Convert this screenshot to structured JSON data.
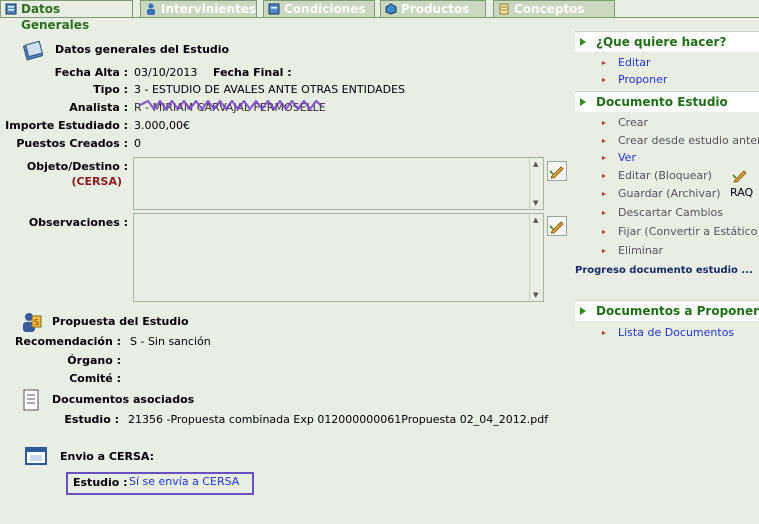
{
  "tabs": [
    {
      "label": "Datos Generales",
      "active": true,
      "icon": "document-icon"
    },
    {
      "label": "Intervinientes",
      "active": false,
      "icon": "person-icon"
    },
    {
      "label": "Condiciones",
      "active": false,
      "icon": "document-icon"
    },
    {
      "label": "Productos",
      "active": false,
      "icon": "cube-icon"
    },
    {
      "label": "Conceptos",
      "active": false,
      "icon": "notes-icon"
    }
  ],
  "general": {
    "title": "Datos generales del Estudio",
    "fecha_alta_label": "Fecha Alta :",
    "fecha_alta_value": "03/10/2013",
    "fecha_final_label": "Fecha Final :",
    "tipo_label": "Tipo :",
    "tipo_value": "3 - ESTUDIO DE AVALES ANTE OTRAS ENTIDADES",
    "analista_label": "Analista :",
    "analista_value": "R - MIRIAM CARVAJAL FERMOSELLE",
    "importe_label": "Importe Estudiado :",
    "importe_value": "3.000,00€",
    "puestos_label": "Puestos Creados :",
    "puestos_value": "0",
    "objeto_label": "Objeto/Destino :",
    "objeto_sub": "(CERSA)",
    "observaciones_label": "Observaciones :"
  },
  "propuesta": {
    "title": "Propuesta del Estudio",
    "recomendacion_label": "Recomendación :",
    "recomendacion_value": "S - Sin sanción",
    "organo_label": "Órgano :",
    "comite_label": "Comité :"
  },
  "documentos": {
    "title": "Documentos asociados",
    "estudio_label": "Estudio :",
    "estudio_value": "21356 -Propuesta combinada Exp 012000000061Propuesta 02_04_2012.pdf"
  },
  "envio": {
    "title": "Envio a CERSA:",
    "estudio_label": "Estudio :",
    "estudio_value": "Sí se envía a CERSA"
  },
  "sidebar": {
    "que_hacer": {
      "title": "¿Que quiere hacer?",
      "items": [
        "Editar",
        "Proponer"
      ]
    },
    "documento_estudio": {
      "title": "Documento Estudio",
      "items": [
        {
          "label": "Crear",
          "enabled": false
        },
        {
          "label": "Crear desde estudio anterior",
          "enabled": false
        },
        {
          "label": "Ver",
          "enabled": true
        },
        {
          "label": "Editar (Bloquear)",
          "enabled": false
        },
        {
          "label": "Guardar (Archivar)",
          "enabled": false
        },
        {
          "label": "Descartar Cambios",
          "enabled": false
        },
        {
          "label": "Fijar (Convertir a Estático)",
          "enabled": false
        },
        {
          "label": "Eliminar",
          "enabled": false
        }
      ],
      "raq_label": "RAQ",
      "progress_label": "Progreso documento estudio ..."
    },
    "documentos_proponer": {
      "title": "Documentos a Proponer",
      "items": [
        "Lista de Documentos"
      ]
    }
  },
  "colors": {
    "tab_active_text": "#2e6f1f",
    "section_head_text": "#1f6f16",
    "link": "#2233cc",
    "cersa_red": "#8b1a1a",
    "highlight_border": "#6a4fbf"
  }
}
